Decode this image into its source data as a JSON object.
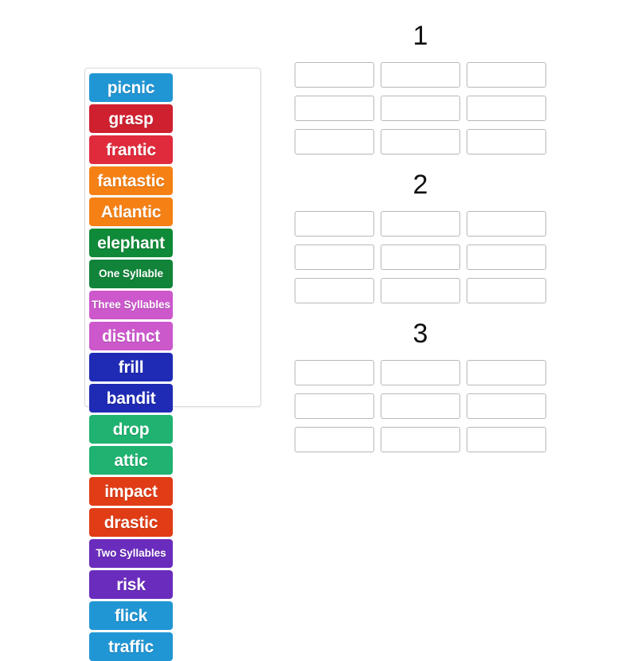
{
  "activity": {
    "type": "word-sort-drag-and-drop",
    "background_color": "#ffffff"
  },
  "word_bank": {
    "name": "word-bank",
    "tiles": [
      {
        "label": "picnic",
        "color": "#2196d4",
        "kind": "word"
      },
      {
        "label": "grasp",
        "color": "#cf2030",
        "kind": "word"
      },
      {
        "label": "frantic",
        "color": "#e02b3c",
        "kind": "word"
      },
      {
        "label": "fantastic",
        "color": "#f58014",
        "kind": "word"
      },
      {
        "label": "Atlantic",
        "color": "#f58014",
        "kind": "word"
      },
      {
        "label": "elephant",
        "color": "#0f8a38",
        "kind": "word"
      },
      {
        "label": "One Syllable",
        "color": "#11843a",
        "kind": "category"
      },
      {
        "label": "Three Syllables",
        "color": "#cc58cc",
        "kind": "category"
      },
      {
        "label": "distinct",
        "color": "#cc58cc",
        "kind": "word"
      },
      {
        "label": "frill",
        "color": "#1f2bb5",
        "kind": "word"
      },
      {
        "label": "bandit",
        "color": "#1f2bb5",
        "kind": "word"
      },
      {
        "label": "drop",
        "color": "#20b271",
        "kind": "word"
      },
      {
        "label": "attic",
        "color": "#20b271",
        "kind": "word"
      },
      {
        "label": "impact",
        "color": "#e03c16",
        "kind": "word"
      },
      {
        "label": "drastic",
        "color": "#e03c16",
        "kind": "word"
      },
      {
        "label": "Two Syllables",
        "color": "#6a2cbd",
        "kind": "category"
      },
      {
        "label": "risk",
        "color": "#6a2cbd",
        "kind": "word"
      },
      {
        "label": "flick",
        "color": "#2196d4",
        "kind": "word"
      },
      {
        "label": "traffic",
        "color": "#2196d4",
        "kind": "word"
      }
    ]
  },
  "drop_groups": [
    {
      "title": "1",
      "slot_count": 9,
      "slots": [
        "",
        "",
        "",
        "",
        "",
        "",
        "",
        "",
        ""
      ]
    },
    {
      "title": "2",
      "slot_count": 9,
      "slots": [
        "",
        "",
        "",
        "",
        "",
        "",
        "",
        "",
        ""
      ]
    },
    {
      "title": "3",
      "slot_count": 9,
      "slots": [
        "",
        "",
        "",
        "",
        "",
        "",
        "",
        "",
        ""
      ]
    }
  ],
  "style": {
    "slot_border_color": "#b8b8b8",
    "panel_border_color": "#d9d9d9",
    "title_color": "#111111"
  }
}
